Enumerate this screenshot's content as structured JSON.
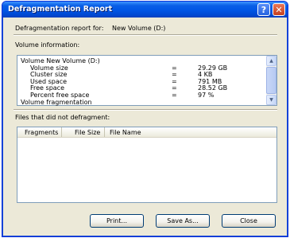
{
  "window": {
    "title": "Defragmentation Report"
  },
  "titlebar": {
    "help_glyph": "?",
    "close_glyph": "✕"
  },
  "report": {
    "heading_prefix": "Defragmentation report for:",
    "volume_name": "New Volume (D:)"
  },
  "volume_info": {
    "label": "Volume information:",
    "rows": [
      {
        "name": "Volume  New Volume (D:)",
        "sep": "",
        "value": "",
        "indent": false
      },
      {
        "name": "Volume size",
        "sep": "=",
        "value": "29.29 GB",
        "indent": true
      },
      {
        "name": "Cluster size",
        "sep": "=",
        "value": "4 KB",
        "indent": true
      },
      {
        "name": "Used space",
        "sep": "=",
        "value": "791 MB",
        "indent": true
      },
      {
        "name": "Free space",
        "sep": "=",
        "value": "28.52 GB",
        "indent": true
      },
      {
        "name": "Percent free space",
        "sep": "=",
        "value": "97 %",
        "indent": true
      },
      {
        "name": "Volume fragmentation",
        "sep": "",
        "value": "",
        "indent": false
      }
    ],
    "scroll_up_glyph": "▲",
    "scroll_down_glyph": "▼"
  },
  "files": {
    "label": "Files that did not defragment:",
    "columns": [
      "Fragments",
      "File Size",
      "File Name"
    ]
  },
  "buttons": {
    "print": "Print...",
    "save_as": "Save As...",
    "close": "Close"
  },
  "colors": {
    "titlebar": "#0055e5",
    "dialog_bg": "#ece9d8",
    "close_red": "#c5401f"
  }
}
